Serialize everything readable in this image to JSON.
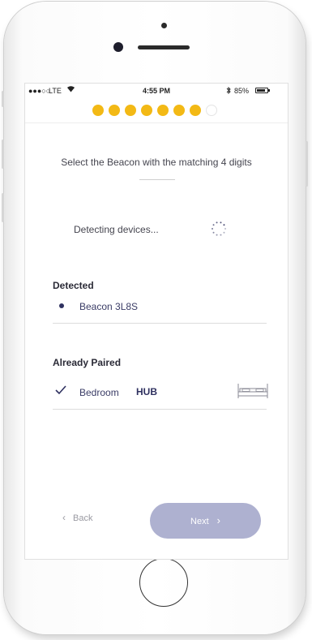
{
  "status_bar": {
    "signal": "●●●○○",
    "carrier": "LTE",
    "wifi_icon": "wifi-icon",
    "time": "4:55 PM",
    "bluetooth_icon": "bluetooth-icon",
    "battery_percent": "85%",
    "battery_level": 0.85
  },
  "progress": {
    "completed_steps": 7,
    "total_steps": 8,
    "accent_color": "#f3b915"
  },
  "instruction": "Select the Beacon with the matching 4 digits",
  "detecting": {
    "label": "Detecting devices...",
    "icon": "loading-spinner-icon"
  },
  "detected": {
    "title": "Detected",
    "items": [
      {
        "label": "Beacon 3L8S",
        "icon": "bullet-icon"
      }
    ]
  },
  "already_paired": {
    "title": "Already Paired",
    "items": [
      {
        "label": "Bedroom",
        "tag": "HUB",
        "icon": "checkmark-icon",
        "device_icon": "bed-icon"
      }
    ]
  },
  "footer": {
    "back_label": "Back",
    "back_icon": "chevron-left-icon",
    "next_label": "Next",
    "next_icon": "chevron-right-icon",
    "next_color": "#aeb1d0"
  }
}
